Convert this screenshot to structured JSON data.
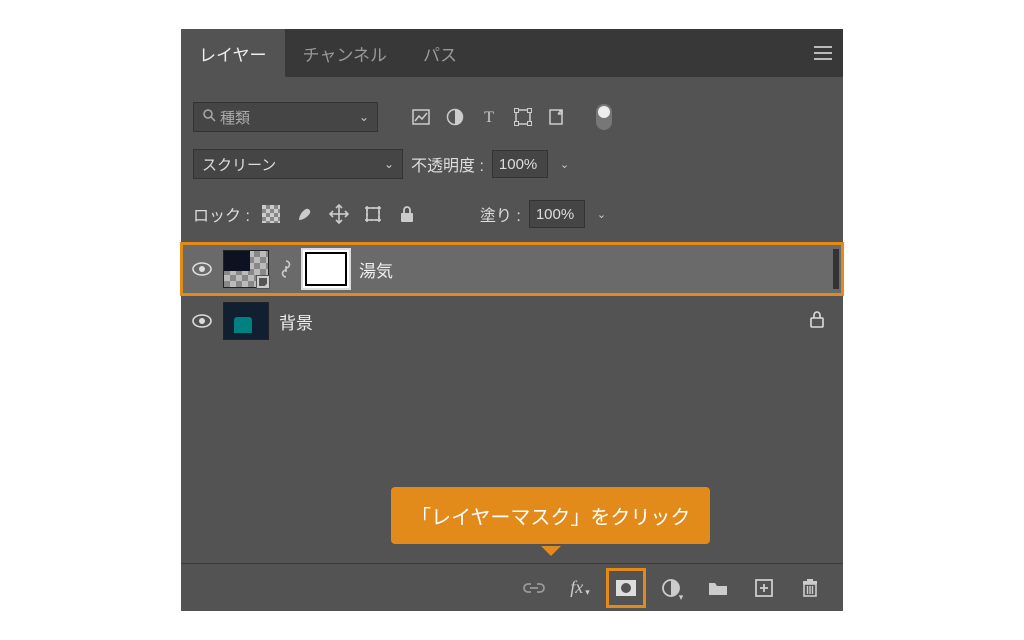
{
  "tabs": {
    "layers": "レイヤー",
    "channels": "チャンネル",
    "paths": "パス"
  },
  "filter": {
    "kind": "種類"
  },
  "blend": {
    "mode": "スクリーン",
    "opacity_label": "不透明度 :",
    "opacity_value": "100%"
  },
  "lock": {
    "label": "ロック :",
    "fill_label": "塗り :",
    "fill_value": "100%"
  },
  "layers": {
    "steam": {
      "name": "湯気"
    },
    "bg": {
      "name": "背景"
    }
  },
  "tooltip": {
    "text": "「レイヤーマスク」をクリック"
  }
}
